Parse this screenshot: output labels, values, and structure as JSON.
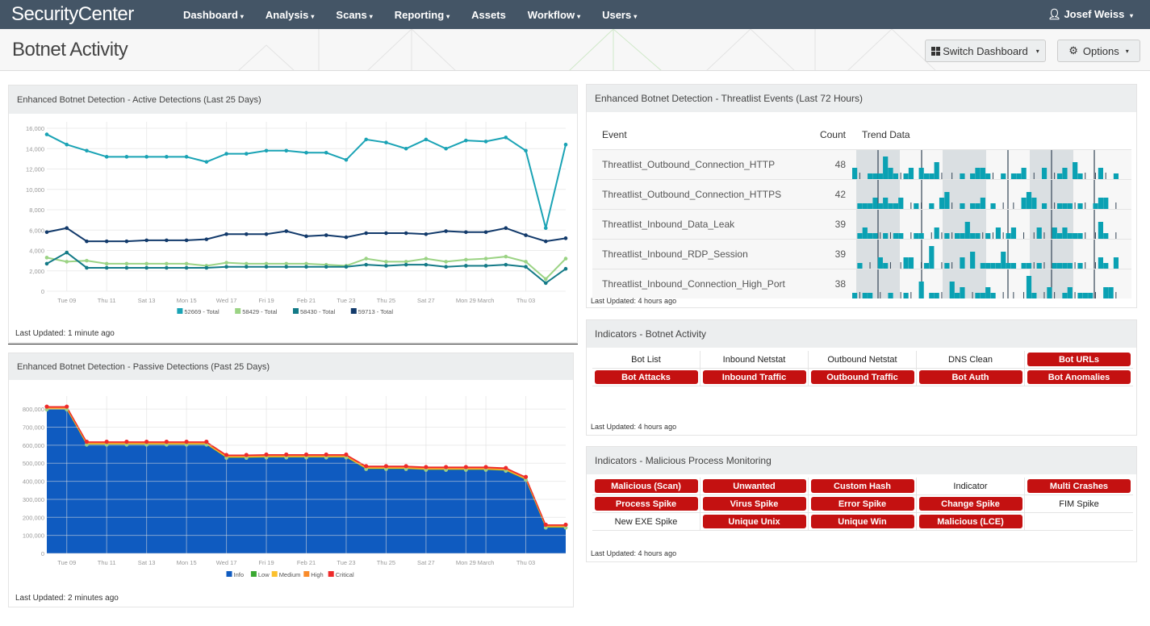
{
  "app": {
    "brand": "SecurityCenter",
    "nav": [
      {
        "label": "Dashboard",
        "caret": true
      },
      {
        "label": "Analysis",
        "caret": true
      },
      {
        "label": "Scans",
        "caret": true
      },
      {
        "label": "Reporting",
        "caret": true
      },
      {
        "label": "Assets",
        "caret": false
      },
      {
        "label": "Workflow",
        "caret": true
      },
      {
        "label": "Users",
        "caret": true
      }
    ],
    "user": "Josef Weiss",
    "caret_glyph": "▾"
  },
  "page": {
    "title": "Botnet Activity",
    "switch_dashboard_label": "Switch Dashboard",
    "options_label": "Options"
  },
  "active_panel": {
    "title": "Enhanced Botnet Detection - Active Detections (Last 25 Days)",
    "last_updated": "Last Updated: 1 minute ago"
  },
  "passive_panel": {
    "title": "Enhanced Botnet Detection - Passive Detections (Past 25 Days)",
    "last_updated": "Last Updated: 2 minutes ago"
  },
  "threatlist_panel": {
    "title": "Enhanced Botnet Detection - Threatlist Events (Last 72 Hours)",
    "columns": [
      "Event",
      "Count",
      "Trend Data"
    ],
    "rows": [
      {
        "event": "Threatlist_Outbound_Connection_HTTP",
        "count": "48",
        "trend": [
          2,
          0,
          0,
          1,
          1,
          1,
          4,
          2,
          1,
          0,
          1,
          2,
          0,
          2,
          1,
          1,
          3,
          0,
          0,
          0,
          0,
          1,
          0,
          1,
          2,
          2,
          1,
          0,
          0,
          1,
          0,
          1,
          1,
          2,
          0,
          0,
          0,
          2,
          0,
          0,
          1,
          2,
          0,
          3,
          1,
          0,
          0,
          0,
          2,
          0,
          0,
          1
        ]
      },
      {
        "event": "Threatlist_Outbound_Connection_HTTPS",
        "count": "42",
        "trend": [
          0,
          1,
          1,
          1,
          2,
          1,
          2,
          1,
          1,
          2,
          0,
          0,
          1,
          0,
          0,
          1,
          0,
          2,
          3,
          0,
          0,
          1,
          0,
          1,
          1,
          2,
          0,
          1,
          0,
          0,
          0,
          0,
          0,
          2,
          3,
          2,
          0,
          1,
          0,
          0,
          1,
          1,
          1,
          0,
          1,
          0,
          0,
          1,
          2,
          2,
          0,
          0
        ]
      },
      {
        "event": "Threatlist_Inbound_Data_Leak",
        "count": "39",
        "trend": [
          0,
          1,
          2,
          1,
          1,
          0,
          1,
          0,
          1,
          1,
          0,
          0,
          1,
          1,
          0,
          0,
          2,
          0,
          1,
          0,
          1,
          1,
          3,
          1,
          1,
          0,
          1,
          0,
          2,
          0,
          1,
          2,
          0,
          0,
          0,
          0,
          2,
          0,
          0,
          2,
          1,
          2,
          1,
          1,
          1,
          0,
          0,
          0,
          3,
          1,
          0,
          0
        ]
      },
      {
        "event": "Threatlist_Inbound_RDP_Session",
        "count": "39",
        "trend": [
          0,
          1,
          0,
          0,
          0,
          2,
          1,
          0,
          0,
          0,
          2,
          2,
          0,
          0,
          1,
          4,
          0,
          0,
          1,
          0,
          0,
          2,
          0,
          3,
          0,
          1,
          1,
          1,
          1,
          3,
          1,
          1,
          0,
          1,
          1,
          0,
          1,
          0,
          0,
          1,
          1,
          1,
          1,
          0,
          1,
          0,
          0,
          0,
          2,
          1,
          0,
          2
        ]
      },
      {
        "event": "Threatlist_Inbound_Connection_High_Port",
        "count": "38",
        "trend": [
          1,
          0,
          1,
          1,
          0,
          0,
          0,
          1,
          0,
          0,
          1,
          0,
          0,
          3,
          0,
          1,
          1,
          0,
          0,
          3,
          1,
          2,
          0,
          0,
          1,
          1,
          2,
          1,
          0,
          0,
          0,
          0,
          0,
          0,
          4,
          1,
          0,
          0,
          2,
          0,
          0,
          1,
          2,
          0,
          1,
          1,
          1,
          0,
          0,
          2,
          2,
          0
        ]
      }
    ],
    "last_updated": "Last Updated: 4 hours ago"
  },
  "botnet_indicators": {
    "title": "Indicators - Botnet Activity",
    "cells": [
      {
        "label": "Bot List",
        "alert": false
      },
      {
        "label": "Inbound Netstat",
        "alert": false
      },
      {
        "label": "Outbound Netstat",
        "alert": false
      },
      {
        "label": "DNS Clean",
        "alert": false
      },
      {
        "label": "Bot URLs",
        "alert": true
      },
      {
        "label": "Bot Attacks",
        "alert": true
      },
      {
        "label": "Inbound Traffic",
        "alert": true
      },
      {
        "label": "Outbound Traffic",
        "alert": true
      },
      {
        "label": "Bot Auth",
        "alert": true
      },
      {
        "label": "Bot Anomalies",
        "alert": true
      }
    ],
    "last_updated": "Last Updated: 4 hours ago"
  },
  "process_indicators": {
    "title": "Indicators - Malicious Process Monitoring",
    "cells": [
      {
        "label": "Malicious (Scan)",
        "alert": true
      },
      {
        "label": "Unwanted",
        "alert": true
      },
      {
        "label": "Custom Hash",
        "alert": true
      },
      {
        "label": "Indicator",
        "alert": false
      },
      {
        "label": "Multi Crashes",
        "alert": true
      },
      {
        "label": "Process Spike",
        "alert": true
      },
      {
        "label": "Virus Spike",
        "alert": true
      },
      {
        "label": "Error Spike",
        "alert": true
      },
      {
        "label": "Change Spike",
        "alert": true
      },
      {
        "label": "FIM Spike",
        "alert": false
      },
      {
        "label": "New EXE Spike",
        "alert": false
      },
      {
        "label": "Unique Unix",
        "alert": true
      },
      {
        "label": "Unique Win",
        "alert": true
      },
      {
        "label": "Malicious (LCE)",
        "alert": true
      },
      {
        "label": "",
        "alert": false
      }
    ],
    "last_updated": "Last Updated: 4 hours ago"
  },
  "chart_data": [
    {
      "type": "line",
      "title": "Enhanced Botnet Detection - Active Detections (Last 25 Days)",
      "xlabel": "",
      "ylabel": "",
      "ylim": [
        0,
        16000
      ],
      "yticks": [
        0,
        2000,
        4000,
        6000,
        8000,
        10000,
        12000,
        14000,
        16000
      ],
      "ytick_labels": [
        "0",
        "2,000",
        "4,000",
        "6,000",
        "8,000",
        "10,000",
        "12,000",
        "14,000",
        "16,000"
      ],
      "x_count": 27,
      "xtick_labels": [
        {
          "i": 1,
          "label": "Tue 09"
        },
        {
          "i": 3,
          "label": "Thu 11"
        },
        {
          "i": 5,
          "label": "Sat 13"
        },
        {
          "i": 7,
          "label": "Mon 15"
        },
        {
          "i": 9,
          "label": "Wed 17"
        },
        {
          "i": 11,
          "label": "Fri 19"
        },
        {
          "i": 13,
          "label": "Feb 21"
        },
        {
          "i": 15,
          "label": "Tue 23"
        },
        {
          "i": 17,
          "label": "Thu 25"
        },
        {
          "i": 19,
          "label": "Sat 27"
        },
        {
          "i": 21,
          "label": "Mon 29"
        },
        {
          "i": 22,
          "label": "March"
        },
        {
          "i": 24,
          "label": "Thu 03"
        }
      ],
      "grid": true,
      "legend": "bottom-center",
      "series": [
        {
          "name": "52669 - Total",
          "color": "#1aa3b5",
          "values": [
            15400,
            14400,
            13800,
            13200,
            13200,
            13200,
            13200,
            13200,
            12700,
            13500,
            13500,
            13800,
            13800,
            13600,
            13600,
            12900,
            14900,
            14600,
            14000,
            14900,
            14000,
            14800,
            14700,
            15100,
            13800,
            6200,
            14400
          ]
        },
        {
          "name": "58429 - Total",
          "color": "#9bd384",
          "values": [
            3300,
            2900,
            3000,
            2700,
            2700,
            2700,
            2700,
            2700,
            2500,
            2800,
            2700,
            2700,
            2700,
            2700,
            2600,
            2500,
            3200,
            2900,
            2900,
            3200,
            2900,
            3100,
            3200,
            3400,
            2900,
            1200,
            3200
          ]
        },
        {
          "name": "58430 - Total",
          "color": "#137a87",
          "values": [
            2700,
            3800,
            2300,
            2300,
            2300,
            2300,
            2300,
            2300,
            2300,
            2400,
            2400,
            2400,
            2400,
            2400,
            2400,
            2400,
            2600,
            2500,
            2600,
            2600,
            2400,
            2500,
            2500,
            2600,
            2400,
            800,
            2200
          ]
        },
        {
          "name": "59713 - Total",
          "color": "#123a6b",
          "values": [
            5800,
            6200,
            4900,
            4900,
            4900,
            5000,
            5000,
            5000,
            5100,
            5600,
            5600,
            5600,
            5900,
            5400,
            5500,
            5300,
            5700,
            5700,
            5700,
            5600,
            5900,
            5800,
            5800,
            6200,
            5500,
            4900,
            5200
          ]
        }
      ]
    },
    {
      "type": "area",
      "stacked": true,
      "title": "Enhanced Botnet Detection - Passive Detections (Past 25 Days)",
      "xlabel": "",
      "ylabel": "",
      "ylim": [
        0,
        850000
      ],
      "yticks": [
        0,
        100000,
        200000,
        300000,
        400000,
        500000,
        600000,
        700000,
        800000
      ],
      "ytick_labels": [
        "0",
        "100,000",
        "200,000",
        "300,000",
        "400,000",
        "500,000",
        "600,000",
        "700,000",
        "800,000"
      ],
      "x_count": 27,
      "xtick_labels": [
        {
          "i": 1,
          "label": "Tue 09"
        },
        {
          "i": 3,
          "label": "Thu 11"
        },
        {
          "i": 5,
          "label": "Sat 13"
        },
        {
          "i": 7,
          "label": "Mon 15"
        },
        {
          "i": 9,
          "label": "Wed 17"
        },
        {
          "i": 11,
          "label": "Fri 19"
        },
        {
          "i": 13,
          "label": "Feb 21"
        },
        {
          "i": 15,
          "label": "Tue 23"
        },
        {
          "i": 17,
          "label": "Thu 25"
        },
        {
          "i": 19,
          "label": "Sat 27"
        },
        {
          "i": 21,
          "label": "Mon 29"
        },
        {
          "i": 22,
          "label": "March"
        },
        {
          "i": 24,
          "label": "Thu 03"
        }
      ],
      "grid": true,
      "legend": "bottom-center",
      "series": [
        {
          "name": "Info",
          "color": "#0f5bc0",
          "values": [
            800000,
            800000,
            605000,
            605000,
            605000,
            605000,
            605000,
            605000,
            605000,
            532000,
            532000,
            534000,
            534000,
            534000,
            534000,
            534000,
            470000,
            470000,
            470000,
            465000,
            465000,
            465000,
            465000,
            460000,
            410000,
            145000,
            145000
          ]
        },
        {
          "name": "Low",
          "color": "#3aa832",
          "values": [
            2000,
            2000,
            2000,
            2000,
            2000,
            2000,
            2000,
            2000,
            2000,
            2000,
            2000,
            2000,
            2000,
            2000,
            2000,
            2000,
            2000,
            2000,
            2000,
            2000,
            2000,
            2000,
            2000,
            2000,
            2000,
            2000,
            2000
          ]
        },
        {
          "name": "Medium",
          "color": "#fbc02d",
          "values": [
            4000,
            4000,
            4000,
            4000,
            4000,
            4000,
            4000,
            4000,
            4000,
            4000,
            4000,
            4000,
            4000,
            4000,
            4000,
            4000,
            4000,
            4000,
            4000,
            4000,
            4000,
            4000,
            4000,
            4000,
            4000,
            4000,
            4000
          ]
        },
        {
          "name": "High",
          "color": "#f98b2a",
          "values": [
            5000,
            5000,
            5000,
            5000,
            5000,
            5000,
            5000,
            5000,
            5000,
            5000,
            5000,
            5000,
            5000,
            5000,
            5000,
            5000,
            5000,
            5000,
            5000,
            5000,
            5000,
            5000,
            5000,
            5000,
            5000,
            5000,
            5000
          ]
        },
        {
          "name": "Critical",
          "color": "#ee2a2a",
          "values": [
            3000,
            3000,
            3000,
            3000,
            3000,
            3000,
            3000,
            3000,
            3000,
            3000,
            3000,
            3000,
            3000,
            3000,
            3000,
            3000,
            3000,
            3000,
            3000,
            3000,
            3000,
            3000,
            3000,
            3000,
            3000,
            3000,
            3000
          ]
        }
      ]
    }
  ]
}
